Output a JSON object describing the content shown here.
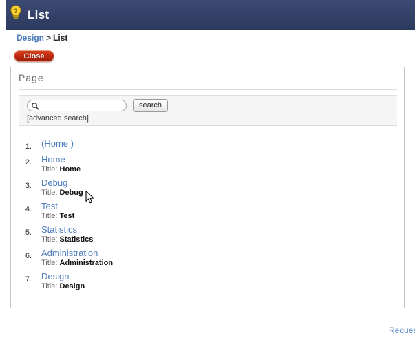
{
  "window": {
    "title": "List",
    "icon": "lightbulb-icon"
  },
  "breadcrumb": {
    "parent": "Design",
    "separator": ">",
    "current": "List"
  },
  "toolbar": {
    "close_label": "Close"
  },
  "panel": {
    "heading": "Page"
  },
  "search": {
    "value": "",
    "placeholder": "",
    "button_label": "search",
    "advanced_label": "[advanced search]",
    "icon": "magnifier-icon"
  },
  "results": {
    "title_prefix": "Title:",
    "items": [
      {
        "index": "1.",
        "link": "(Home )",
        "title": ""
      },
      {
        "index": "2.",
        "link": "Home",
        "title": "Home"
      },
      {
        "index": "3.",
        "link": "Debug",
        "title": "Debug"
      },
      {
        "index": "4.",
        "link": "Test",
        "title": "Test"
      },
      {
        "index": "5.",
        "link": "Statistics",
        "title": "Statistics"
      },
      {
        "index": "6.",
        "link": "Administration",
        "title": "Administration"
      },
      {
        "index": "7.",
        "link": "Design",
        "title": "Design"
      }
    ]
  },
  "footer": {
    "brand": "Requea"
  },
  "colors": {
    "titlebar": "#35436b",
    "link": "#4d7cba",
    "close_button": "#c32d13",
    "panel_border": "#c6c6c6",
    "search_bg": "#f5f5f5"
  }
}
